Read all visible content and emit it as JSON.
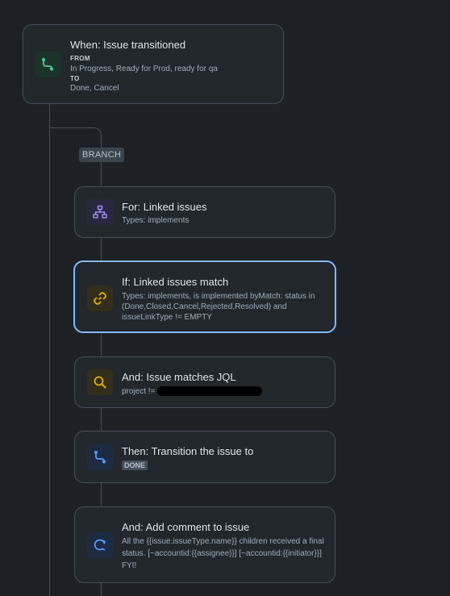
{
  "trigger": {
    "title": "When: Issue transitioned",
    "from_label": "FROM",
    "from_value": "In Progress, Ready for Prod, ready for qa",
    "to_label": "TO",
    "to_value": "Done, Cancel",
    "icon": "transition-icon"
  },
  "branch_label": "BRANCH",
  "steps": [
    {
      "title": "For: Linked issues",
      "detail": "Types: implements",
      "icon": "hierarchy-icon"
    },
    {
      "title": "If: Linked issues match",
      "detail_lines": [
        "Types: implements, is implemented byMatch: status in",
        "(Done,Closed,Cancel,Rejected,Resolved) and",
        "issueLinkType != EMPTY"
      ],
      "icon": "link-icon"
    },
    {
      "title": "And: Issue matches JQL",
      "detail": "project != ",
      "icon": "search-icon"
    },
    {
      "title": "Then: Transition the issue to",
      "status": "DONE",
      "icon": "transition-icon"
    },
    {
      "title": "And: Add comment to issue",
      "detail_lines": [
        "All the {{issue.issueType.name}} children received a final",
        "status. [~accountid:{{assignee}}] [~accountid:{{initiator}}]",
        "FYI!"
      ],
      "icon": "comment-refresh-icon"
    }
  ],
  "colors": {
    "background": "#1d2125",
    "card": "#22272b",
    "selected_border": "#85b8ff",
    "green_icon": "#4bce97",
    "purple_icon": "#9f8fef",
    "yellow_icon": "#e2b203",
    "blue_icon": "#579dff"
  }
}
